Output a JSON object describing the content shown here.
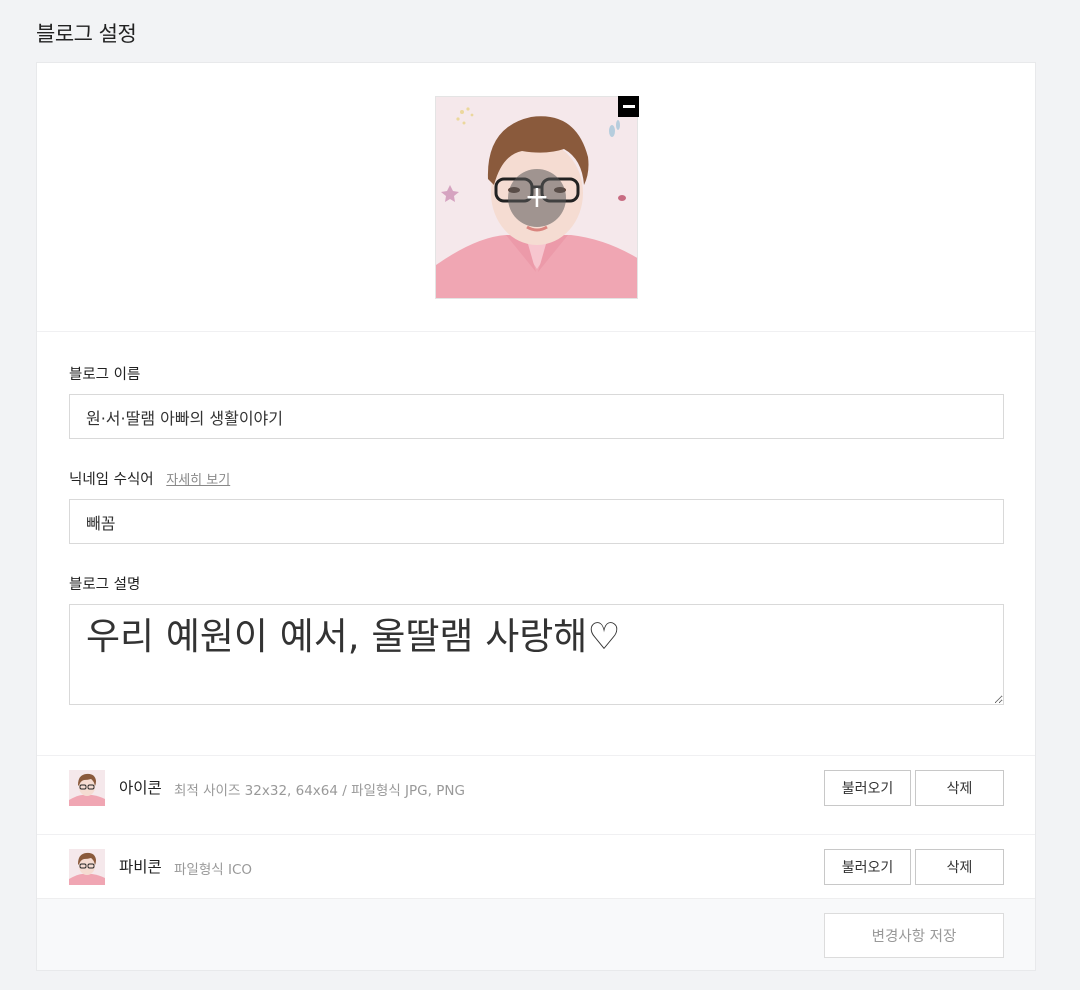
{
  "page": {
    "title": "블로그 설정"
  },
  "profile": {
    "image_alt": "blog-profile-illustration",
    "add_symbol": "+",
    "remove_symbol": "−"
  },
  "blog_name": {
    "label": "블로그 이름",
    "value": "원·서·딸램 아빠의 생활이야기"
  },
  "nickname": {
    "label": "닉네임 수식어",
    "more_link": "자세히 보기",
    "value": "빼꼼"
  },
  "description": {
    "label": "블로그 설명",
    "value": "우리 예원이 예서, 울딸램 사랑해♡"
  },
  "icon_row": {
    "title": "아이콘",
    "desc": "최적 사이즈 32x32, 64x64 / 파일형식 JPG, PNG",
    "load_label": "불러오기",
    "delete_label": "삭제"
  },
  "favicon_row": {
    "title": "파비콘",
    "desc": "파일형식 ICO",
    "load_label": "불러오기",
    "delete_label": "삭제"
  },
  "footer": {
    "save_label": "변경사항 저장"
  },
  "colors": {
    "background": "#f2f3f5",
    "card": "#ffffff",
    "border": "#d9d9d9",
    "muted_text": "#999999"
  }
}
